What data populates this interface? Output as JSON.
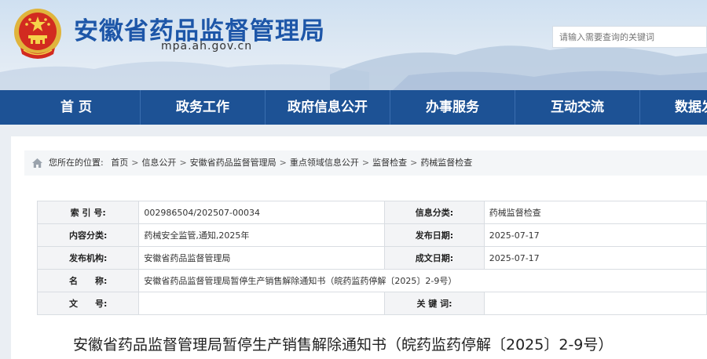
{
  "header": {
    "site_title": "安徽省药品监督管理局",
    "site_domain": "mpa.ah.gov.cn",
    "search_placeholder": "请输入需要查询的关键词"
  },
  "nav": {
    "items": [
      "首 页",
      "政务工作",
      "政府信息公开",
      "办事服务",
      "互动交流",
      "数据发布"
    ]
  },
  "breadcrumb": {
    "prefix": "您所在的位置:",
    "items": [
      "首页",
      "信息公开",
      "安徽省药品监督管理局",
      "重点领域信息公开",
      "监督检查",
      "药械监督检查"
    ],
    "separator": ">"
  },
  "meta": {
    "index_label": "索 引 号:",
    "index_value": "002986504/202507-00034",
    "info_category_label": "信息分类:",
    "info_category_value": "药械监督检查",
    "content_category_label": "内容分类:",
    "content_category_value": "药械安全监管,通知,2025年",
    "publish_date_label": "发布日期:",
    "publish_date_value": "2025-07-17",
    "publisher_label": "发布机构:",
    "publisher_value": "安徽省药品监督管理局",
    "created_date_label": "成文日期:",
    "created_date_value": "2025-07-17",
    "name_label": "名　　称:",
    "name_value": "安徽省药品监督管理局暂停生产销售解除通知书（皖药监药停解〔2025〕2-9号）",
    "doc_no_label": "文　　号:",
    "doc_no_value": "",
    "keywords_label": "关 键 词:",
    "keywords_value": ""
  },
  "document": {
    "title": "安徽省药品监督管理局暂停生产销售解除通知书（皖药监药停解〔2025〕2-9号）"
  },
  "colors": {
    "nav_bg": "#1d5295",
    "title_blue": "#1d56a8",
    "page_bg": "#eaeef3"
  }
}
